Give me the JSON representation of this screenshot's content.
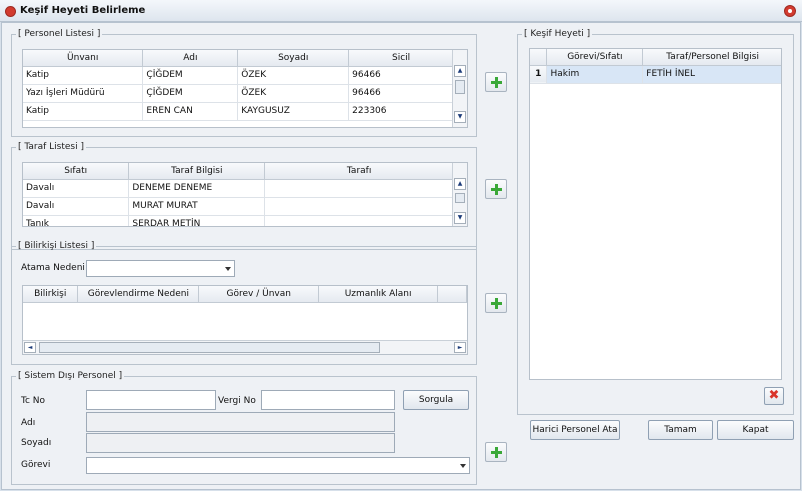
{
  "window": {
    "title": "Keşif Heyeti Belirleme"
  },
  "personel": {
    "legend": "[ Personel Listesi ]",
    "columns": [
      "Ünvanı",
      "Adı",
      "Soyadı",
      "Sicil"
    ],
    "rows": [
      [
        "Katip",
        "ÇİĞDEM",
        "ÖZEK",
        "96466"
      ],
      [
        "Yazı İşleri Müdürü",
        "ÇİĞDEM",
        "ÖZEK",
        "96466"
      ],
      [
        "Katip",
        "EREN CAN",
        "KAYGUSUZ",
        "223306"
      ]
    ]
  },
  "taraf": {
    "legend": "[ Taraf Listesi ]",
    "columns": [
      "Sıfatı",
      "Taraf Bilgisi",
      "Tarafı"
    ],
    "rows": [
      [
        "Davalı",
        "DENEME DENEME",
        ""
      ],
      [
        "Davalı",
        "MURAT MURAT",
        ""
      ],
      [
        "Tanık",
        "SERDAR METİN",
        ""
      ]
    ]
  },
  "bilirkisi": {
    "legend": "[ Bilirkişi Listesi ]",
    "atama_label": "Atama Nedeni",
    "atama_value": "",
    "columns": [
      "Bilirkişi",
      "Görevlendirme Nedeni",
      "Görev / Ünvan",
      "Uzmanlık Alanı"
    ]
  },
  "sistem_disi": {
    "legend": "[ Sistem Dışı Personel ]",
    "tcno_label": "Tc No",
    "tcno_value": "",
    "vergino_label": "Vergi No",
    "vergino_value": "",
    "sorgula_label": "Sorgula",
    "adi_label": "Adı",
    "soyadi_label": "Soyadı",
    "gorevi_label": "Görevi"
  },
  "kesif": {
    "legend": "[ Keşif Heyeti ]",
    "columns": [
      "Görevi/Sıfatı",
      "Taraf/Personel Bilgisi"
    ],
    "rows": [
      {
        "no": "1",
        "gorevi": "Hakim",
        "bilgi": "FETİH İNEL"
      }
    ]
  },
  "buttons": {
    "harici": "Harici Personel Ata",
    "tamam": "Tamam",
    "kapat": "Kapat"
  },
  "icons": {
    "add": "plus-icon",
    "delete": "delete-icon",
    "close": "close-icon"
  },
  "colors": {
    "add_green": "#3aa838",
    "delete_red": "#d9342b"
  }
}
